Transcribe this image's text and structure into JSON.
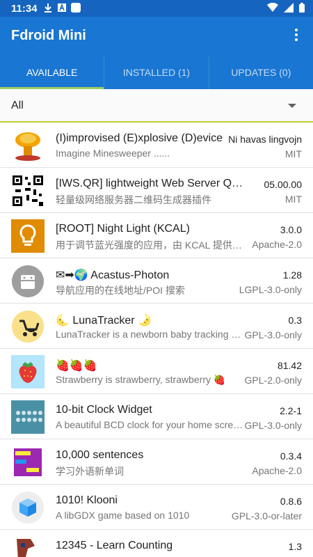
{
  "status": {
    "time": "11:34"
  },
  "app": {
    "title": "Fdroid Mini"
  },
  "tabs": [
    {
      "label": "AVAILABLE",
      "active": true
    },
    {
      "label": "INSTALLED (1)",
      "active": false
    },
    {
      "label": "UPDATES (0)",
      "active": false
    }
  ],
  "filter": {
    "value": "All"
  },
  "apps": [
    {
      "name": "(I)improvised (E)xplosive (D)evice",
      "summary": "Imagine Minesweeper ......",
      "version": "Ni havas lingvojn",
      "license": "MIT",
      "icon": "mushroom-cloud-icon"
    },
    {
      "name": "[IWS.QR] lightweight Web Server QR code",
      "summary": "轻量级网络服务器二维码生成器插件",
      "version": "05.00.00",
      "license": "MIT",
      "icon": "qr-code-icon"
    },
    {
      "name": "[ROOT] Night Light (KCAL)",
      "summary": "用于调节蓝光强度的应用，由 KCAL 提供支持",
      "version": "3.0.0",
      "license": "Apache-2.0",
      "icon": "lightbulb-icon"
    },
    {
      "name": "✉➡🌍 Acastus-Photon",
      "summary": "导航应用的在线地址/POI 搜索",
      "version": "1.28",
      "license": "LGPL-3.0-only",
      "icon": "android-robot-icon"
    },
    {
      "name": "🌜 LunaTracker 🌛",
      "summary": "LunaTracker is a newborn baby tracking app",
      "version": "0.3",
      "license": "GPL-3.0-only",
      "icon": "baby-stroller-icon"
    },
    {
      "name": "🍓🍓🍓",
      "summary": "Strawberry is strawberry, strawberry 🍓",
      "version": "81.42",
      "license": "GPL-2.0-only",
      "icon": "strawberry-icon"
    },
    {
      "name": "10-bit Clock Widget",
      "summary": "A beautiful BCD clock for your home screen",
      "version": "2.2-1",
      "license": "GPL-3.0-only",
      "icon": "bcd-clock-icon"
    },
    {
      "name": "10,000 sentences",
      "summary": "学习外语新单词",
      "version": "0.3.4",
      "license": "Apache-2.0",
      "icon": "sentences-icon"
    },
    {
      "name": "1010! Klooni",
      "summary": "A libGDX game based on 1010",
      "version": "0.8.6",
      "license": "GPL-3.0-or-later",
      "icon": "cube-icon"
    },
    {
      "name": "12345 - Learn Counting",
      "summary": "",
      "version": "1.3",
      "license": "",
      "icon": "counting-icon"
    }
  ]
}
